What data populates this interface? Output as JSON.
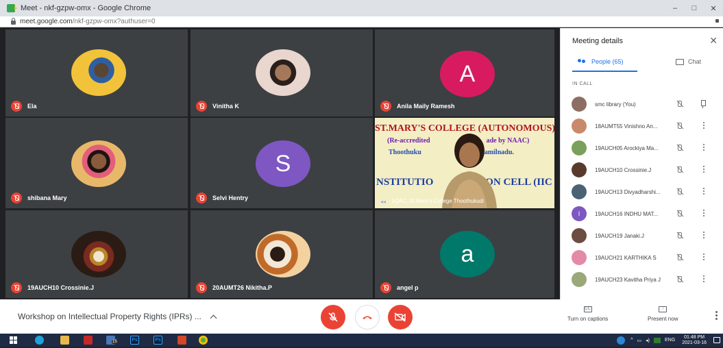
{
  "browser": {
    "tab_title": "Meet - nkf-gzpw-omx - Google Chrome",
    "url_host": "meet.google.com",
    "url_path": "/nkf-gzpw-omx?authuser=0",
    "window_controls": [
      "–",
      "□",
      "✕"
    ]
  },
  "tiles": [
    {
      "name": "Ela",
      "kind": "photo",
      "color": "#f2c33a"
    },
    {
      "name": "Vinitha K",
      "kind": "photo",
      "color": "#e8d6cf"
    },
    {
      "name": "Anila Maily Ramesh",
      "kind": "letter",
      "letter": "A",
      "color": "#d81b60"
    },
    {
      "name": "shibana Mary",
      "kind": "photo",
      "color": "#e8b86a"
    },
    {
      "name": "Selvi Hentry",
      "kind": "letter",
      "letter": "S",
      "color": "#7e57c2"
    },
    {
      "name": "19AUCH10 Crossinie.J",
      "kind": "photo",
      "color": "#5a3a2c"
    },
    {
      "name": "20AUMT26 Nikitha.P",
      "kind": "photo",
      "color": "#d9843a"
    },
    {
      "name": "angel p",
      "kind": "letter",
      "letter": "a",
      "color": "#00796b"
    }
  ],
  "presentation": {
    "line1": "ST.MARY'S COLLEGE (AUTONOMOUS)",
    "line2": "(Re-accredited",
    "line2b": "ade by NAAC)",
    "line3": "Thoothuku",
    "line3b": "amilnadu.",
    "line4": "NSTITUTIO",
    "line4b": "ION CELL (IIC",
    "presenter": "1QAC, St.Mary's College Thoothukudi"
  },
  "meetbar": {
    "meeting_title": "Workshop on Intellectual Property Rights (IPRs) ...",
    "captions_label": "Turn on captions",
    "present_label": "Present now",
    "captions_icon_text": "CC"
  },
  "panel": {
    "title": "Meeting details",
    "close": "✕",
    "people_tab": "People (65)",
    "chat_tab": "Chat",
    "section": "IN CALL",
    "participants": [
      {
        "name": "smc library (You)",
        "color": "#8d6e63",
        "you": true
      },
      {
        "name": "18AUMT55 Vinishno An...",
        "color": "#c98a6b"
      },
      {
        "name": "19AUCH05 Arockiya Ma...",
        "color": "#7ba05b"
      },
      {
        "name": "19AUCH10 Crossinie.J",
        "color": "#5a3a2c"
      },
      {
        "name": "19AUCH13 Divyadharshi...",
        "color": "#4a6274"
      },
      {
        "name": "19AUCH16 INDHU MAT...",
        "color": "#7e57c2",
        "letter": "I"
      },
      {
        "name": "19AUCH19 Janaki.J",
        "color": "#6d4c41"
      },
      {
        "name": "19AUCH21 KARTHIKA S",
        "color": "#e28aa6"
      },
      {
        "name": "19AUCH23 Kavitha Priya J",
        "color": "#9aa87a"
      }
    ]
  },
  "taskbar": {
    "time": "01:48 PM",
    "date": "2021-03-16",
    "lang": "ENG",
    "badge": "15"
  }
}
